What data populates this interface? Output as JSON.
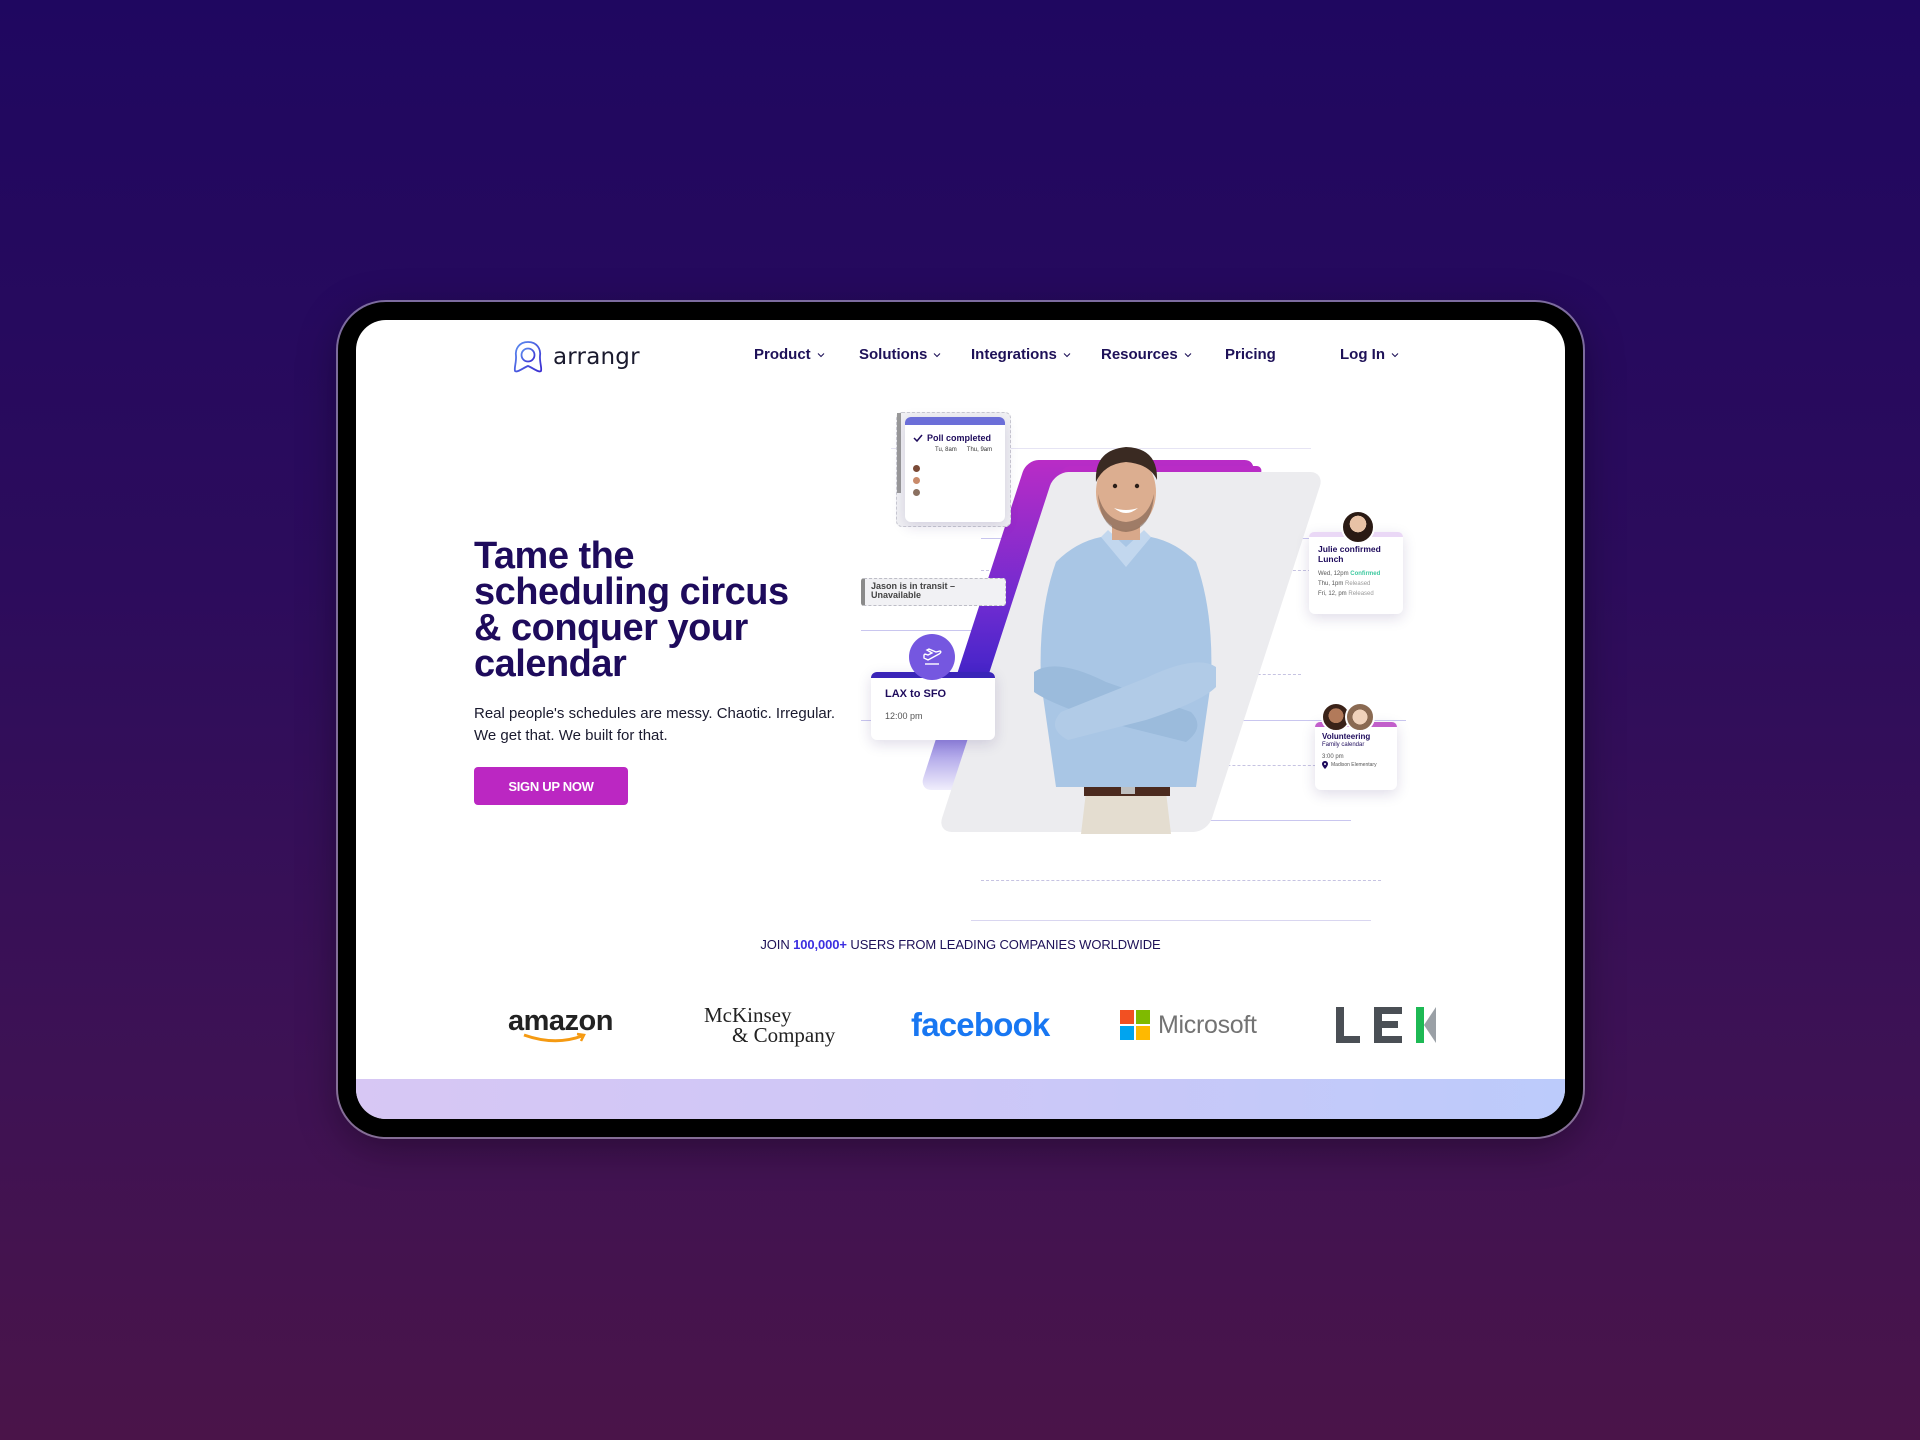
{
  "brand": {
    "name": "arrangr",
    "logo_icon": "arrangr-logo-icon"
  },
  "nav": {
    "items": [
      {
        "label": "Product",
        "has_dropdown": true
      },
      {
        "label": "Solutions",
        "has_dropdown": true
      },
      {
        "label": "Integrations",
        "has_dropdown": true
      },
      {
        "label": "Resources",
        "has_dropdown": true
      },
      {
        "label": "Pricing",
        "has_dropdown": false
      }
    ],
    "login": {
      "label": "Log In",
      "has_dropdown": true
    }
  },
  "hero": {
    "title_lines": [
      "Tame the",
      "scheduling circus",
      "& conquer your",
      "calendar"
    ],
    "subtitle_lines": [
      "Real people's schedules are messy. Chaotic. Irregular.",
      "We get that. We built for that."
    ],
    "cta_label": "SIGN UP NOW"
  },
  "illustration": {
    "poll_card": {
      "title": "Poll completed",
      "options": [
        "Tu, 8am",
        "Thu, 9am"
      ],
      "check_icon": "check-icon"
    },
    "transit_card": {
      "lines": [
        "Jason is in transit –",
        "Unavailable"
      ]
    },
    "flight_card": {
      "title": "LAX to SFO",
      "time": "12:00 pm",
      "icon": "airplane-departure-icon"
    },
    "lunch_card": {
      "title_lines": [
        "Julie confirmed",
        "Lunch"
      ],
      "rows": [
        {
          "time": "Wed, 12pm",
          "status": "Confirmed"
        },
        {
          "time": "Thu, 1pm",
          "status": "Released"
        },
        {
          "time": "Fri, 12, pm",
          "status": "Released"
        }
      ]
    },
    "volunteer_card": {
      "title": "Volunteering",
      "calendar": "Family calendar",
      "time": "3:00 pm",
      "location": "Madison Elementary",
      "icon": "map-pin-icon"
    }
  },
  "social_proof": {
    "prefix": "JOIN ",
    "highlight": "100,000+",
    "suffix": " USERS FROM LEADING COMPANIES WORLDWIDE",
    "logos": [
      {
        "name": "amazon",
        "text": "amazon"
      },
      {
        "name": "mckinsey",
        "line1": "McKinsey",
        "line2": "& Company"
      },
      {
        "name": "facebook",
        "text": "facebook"
      },
      {
        "name": "microsoft",
        "text": "Microsoft"
      },
      {
        "name": "lek",
        "text": "LEK"
      }
    ]
  },
  "colors": {
    "primary_dark": "#1e0b5c",
    "cta": "#bb27c2",
    "accent_blue": "#3c2fe0",
    "confirmed": "#3ec9a0",
    "released": "#9a9a9a",
    "facebook": "#1877f2"
  }
}
